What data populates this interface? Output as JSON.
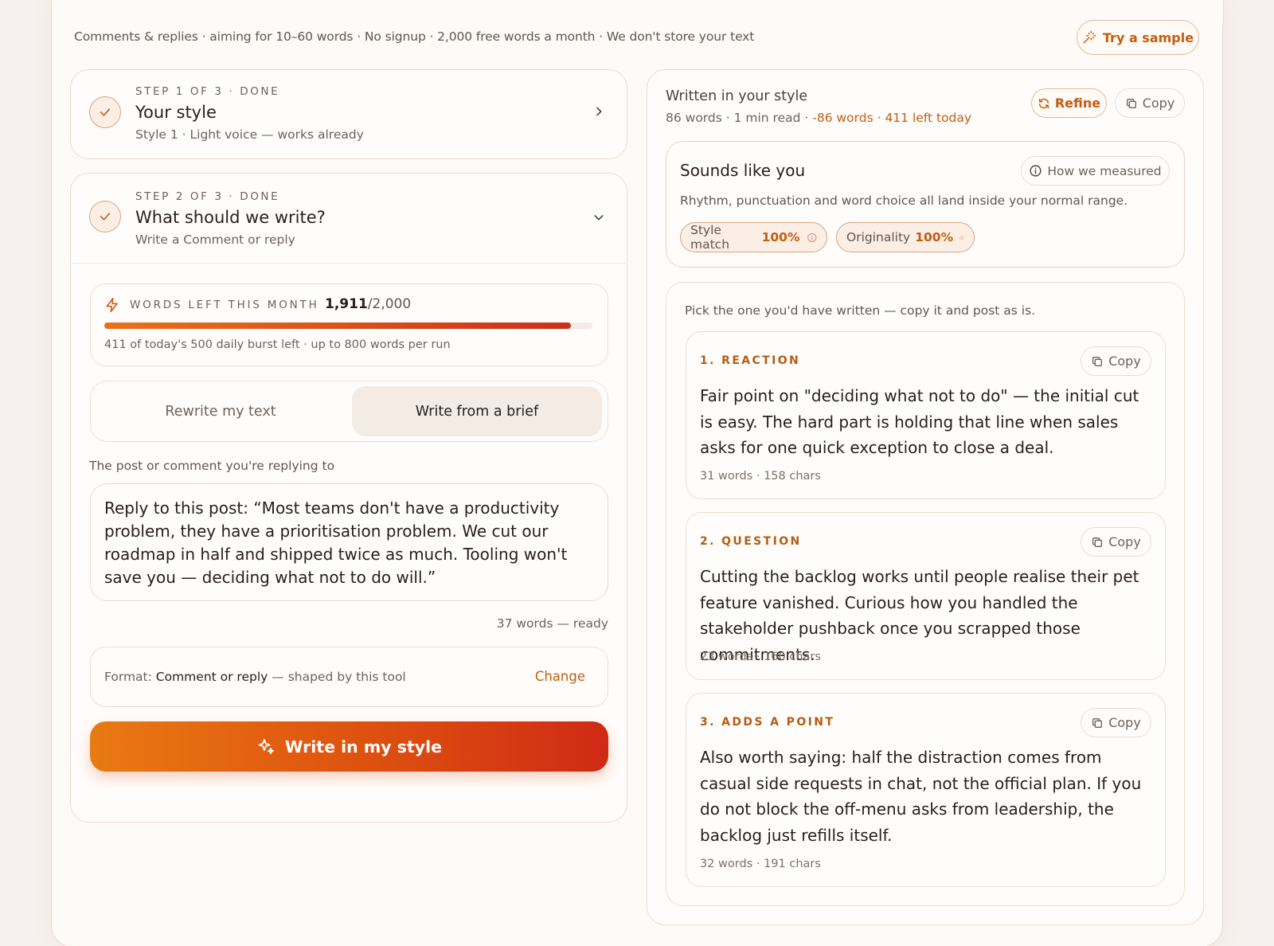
{
  "header": {
    "note": "Comments & replies · aiming for 10–60 words · No signup · 2,000 free words a month · We don't store your text",
    "sample_label": "Try a sample"
  },
  "step1": {
    "eyebrow": "STEP 1 OF 3 · DONE",
    "title": "Your style",
    "subtitle": "Style 1 · Light voice — works already"
  },
  "step2": {
    "eyebrow": "STEP 2 OF 3 · DONE",
    "title": "What should we write?",
    "subtitle": "Write a Comment or reply"
  },
  "quota": {
    "label": "WORDS LEFT THIS MONTH",
    "used": "1,911",
    "total": "/2,000",
    "fill_fraction": 0.9555,
    "note": "411 of today's 500 daily burst left · up to 800 words per run"
  },
  "mode": {
    "options": [
      "Rewrite my text",
      "Write from a brief"
    ],
    "selected": "Write from a brief"
  },
  "input": {
    "label": "The post or comment you're replying to",
    "value": "Reply to this post: “Most teams don't have a productivity problem, they have a prioritisation problem. We cut our roadmap in half and shipped twice as much. Tooling won't save you — deciding what not to do will.”",
    "counter": "37 words — ready"
  },
  "format": {
    "prefix": "Format:",
    "value": "Comment or reply",
    "suffix": "— shaped by this tool",
    "change_label": "Change"
  },
  "write_button": "Write in my style",
  "result": {
    "title": "Written in your style",
    "meta_plain": "86 words · 1 min read ·",
    "meta_accent": "-86 words · 411 left today",
    "refine_label": "Refine",
    "copy_label": "Copy"
  },
  "sounds": {
    "title": "Sounds like you",
    "how_label": "How we measured",
    "description": "Rhythm, punctuation and word choice all land inside your normal range.",
    "badges": [
      {
        "label": "Style match",
        "value": "100%"
      },
      {
        "label": "Originality",
        "value": "100%"
      }
    ]
  },
  "options": {
    "intro": "Pick the one you'd have written — copy it and post as is.",
    "copy_label": "Copy",
    "items": [
      {
        "label": "1. REACTION",
        "text": "Fair point on \"deciding what not to do\" — the initial cut is easy. The hard part is holding that line when sales asks for one quick exception to close a deal.",
        "meta": "31 words · 158 chars"
      },
      {
        "label": "2. QUESTION",
        "text": "Cutting the backlog works until people realise their pet feature vanished. Curious how you handled the stakeholder pushback once you scrapped those commitments.",
        "meta": "23 words · 160 chars"
      },
      {
        "label": "3. ADDS A POINT",
        "text": "Also worth saying: half the distraction comes from casual side requests in chat, not the official plan. If you do not block the off-menu asks from leadership, the backlog just refills itself.",
        "meta": "32 words · 191 chars"
      }
    ]
  },
  "colors": {
    "accent": "#c25e12",
    "gradient_start": "#e97a12",
    "gradient_end": "#cf2a15",
    "border": "#eddcd2"
  }
}
